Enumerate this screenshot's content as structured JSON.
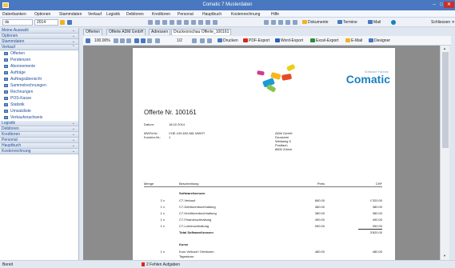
{
  "window": {
    "title": "Comatic 7 Musterdaten"
  },
  "menu": [
    "Datenbanken",
    "Optionen",
    "Stammdaten",
    "Verkauf",
    "Logistik",
    "Debitoren",
    "Kreditoren",
    "Personal",
    "Hauptbuch",
    "Kostenrechnung",
    "Hilfe"
  ],
  "toolbar": {
    "db_value": "ds",
    "year_value": "2014",
    "buttons": {
      "documents": "Dokumente",
      "appointments": "Termine",
      "mail": "Mail"
    },
    "close_label": "Schliessen"
  },
  "sidebar": {
    "groups_top": [
      "Meine Auswahl",
      "Optionen",
      "Stammdaten",
      "Verkauf"
    ],
    "verkauf_items": [
      "Offerten",
      "Pendenzen",
      "Abonnemente",
      "Aufträge",
      "Auftragsübersicht",
      "Sammelrechnungen",
      "Rechnungen",
      "POS-Kasse",
      "Statistik",
      "Umsatzliste",
      "Verkaufsnachweis"
    ],
    "groups_bottom": [
      "Logistik",
      "Debitoren",
      "Kreditoren",
      "Personal",
      "Hauptbuch",
      "Kostenrechnung"
    ]
  },
  "tabs": [
    "Offerten",
    "Offerte ADM GmbH",
    "Adressen",
    "Druckvorschau Offerte_100161"
  ],
  "viewer_toolbar": {
    "zoom": "100.00%",
    "page": "1/2",
    "print": "Drucken",
    "pdf": "PDF-Export",
    "word": "Word-Export",
    "excel": "Excel-Export",
    "email": "E-Mail",
    "designer": "Designer"
  },
  "document": {
    "logo_tagline": "Software Factory",
    "logo_name": "Comatic",
    "heading": "Offerte Nr. 100161",
    "meta": [
      {
        "label": "Datum:",
        "value": "18.02.2014"
      },
      {
        "label": "MWSt-Nr.:",
        "value": "CHE-109.632.881 MWST"
      },
      {
        "label": "Kunden-Nr.:",
        "value": "1"
      }
    ],
    "recipient": [
      "ADM GmbH",
      "Druckerei",
      "Weidweg 5",
      "Postfach",
      "8800 Zürich"
    ],
    "columns": {
      "qty": "Menge",
      "desc": "Beschreibung",
      "price": "Preis",
      "total": "CHF"
    },
    "section1": "Softwarelizenzen",
    "lines": [
      {
        "qty": "2 x",
        "desc": "C7-Verkauf",
        "price": "660.00",
        "total": "1'320.00"
      },
      {
        "qty": "1 x",
        "desc": "C7-Debitorenbuchhaltung",
        "price": "380.00",
        "total": "380.00"
      },
      {
        "qty": "1 x",
        "desc": "C7-Kreditorenbuchhaltung",
        "price": "380.00",
        "total": "380.00"
      },
      {
        "qty": "1 x",
        "desc": "C7-Finanzbuchhaltung",
        "price": "490.00",
        "total": "490.00"
      },
      {
        "qty": "1 x",
        "desc": "C7-Lohnbuchhaltung",
        "price": "990.00",
        "total": "990.00"
      }
    ],
    "subtotal_label": "Total Softwarelizenzen",
    "subtotal_value": "3'620.00",
    "section2": "Kurse",
    "course": {
      "qty": "1 x",
      "desc": "Kurs Verkauf / Debitoren",
      "desc2": "Tageskurs",
      "price": "480.00",
      "total": "480.00"
    }
  },
  "status": {
    "left": "Bereit",
    "errors": "2 Fehlen Aufgaben"
  },
  "colors": {
    "titlebar": "#4a78c0",
    "accent": "#1f4e99",
    "logo_blue": "#1a7fc1",
    "error": "#d9261c"
  }
}
